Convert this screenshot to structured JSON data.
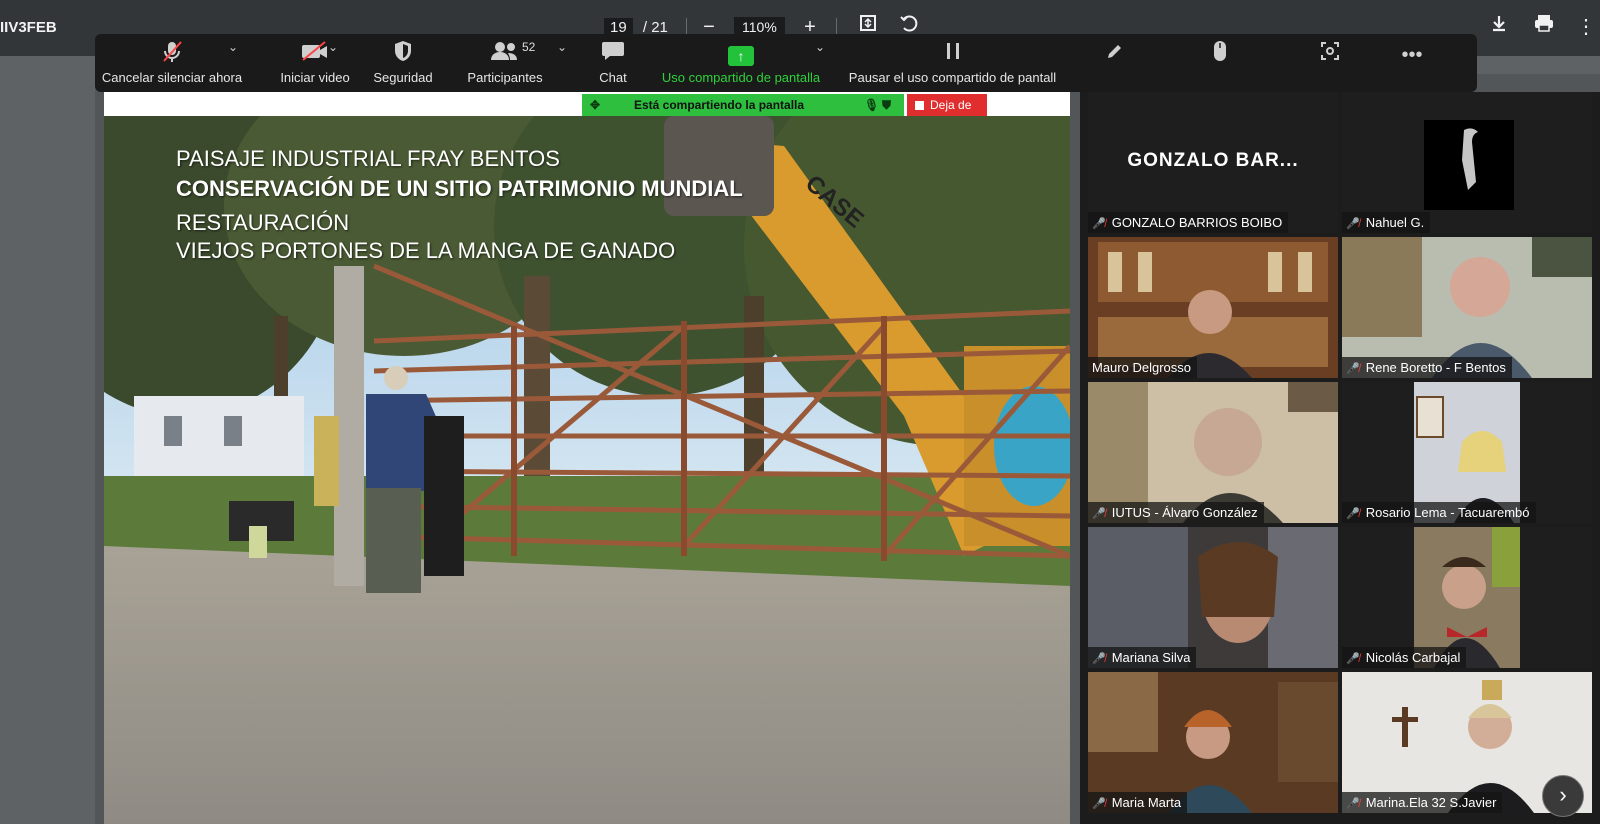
{
  "pdf_viewer": {
    "title": "IIV3FEB",
    "current_page": "19",
    "page_separator": "/",
    "total_pages": "21",
    "zoom": "110%"
  },
  "toolbar": {
    "mute_label": "Cancelar silenciar ahora",
    "video_label": "Iniciar video",
    "security_label": "Seguridad",
    "participants_label": "Participantes",
    "participants_count": "52",
    "chat_label": "Chat",
    "share_label": "Uso compartido de pantalla",
    "pause_label": "Pausar el uso compartido de pantall"
  },
  "sharing": {
    "banner_text": "Está compartiendo la pantalla",
    "stop_label": "Deja de"
  },
  "slide": {
    "line1": "PAISAJE INDUSTRIAL FRAY BENTOS",
    "line2": "CONSERVACIÓN DE UN SITIO PATRIMONIO MUNDIAL",
    "line3": "RESTAURACIÓN",
    "line4": "VIEJOS PORTONES DE LA MANGA DE GANADO",
    "machine_brand": "CASE"
  },
  "participants": [
    {
      "name": "GONZALO BARRIOS BOIBO",
      "display": "GONZALO  BAR...",
      "muted": true
    },
    {
      "name": "Nahuel G.",
      "muted": true
    },
    {
      "name": "Mauro Delgrosso",
      "muted": false,
      "active": true
    },
    {
      "name": "Rene Boretto - F Bentos",
      "muted": true
    },
    {
      "name": "IUTUS - Álvaro González",
      "muted": true
    },
    {
      "name": "Rosario Lema - Tacuarembó",
      "muted": true
    },
    {
      "name": "Mariana Silva",
      "muted": true
    },
    {
      "name": "Nicolás Carbajal",
      "muted": true
    },
    {
      "name": "Maria Marta",
      "muted": true
    },
    {
      "name": "Marina.Ela 32 S.Javier",
      "muted": true
    }
  ],
  "colors": {
    "zoom_green": "#2fd13a",
    "stop_red": "#e02d2d",
    "active_speaker": "#d8df6a"
  }
}
